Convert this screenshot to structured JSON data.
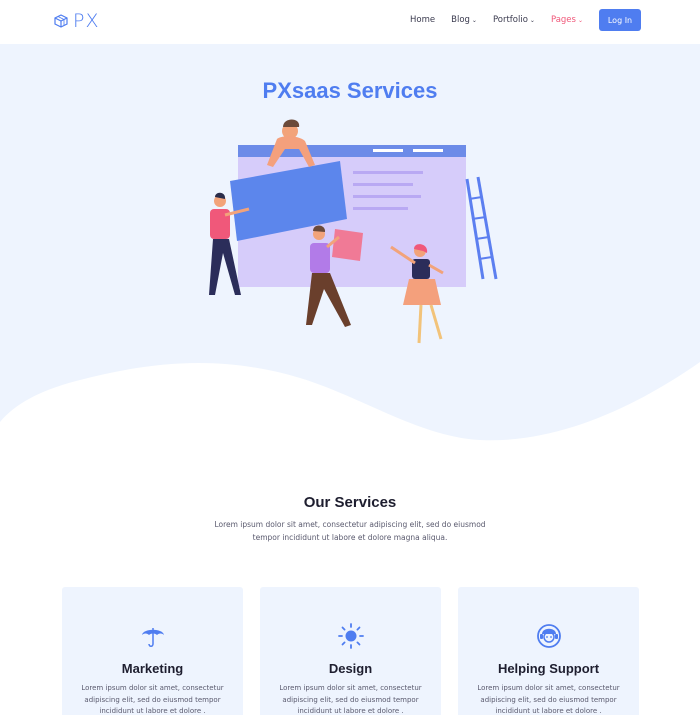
{
  "brand": {
    "logo_text": "PX"
  },
  "nav": {
    "items": [
      {
        "label": "Home",
        "has_dropdown": false,
        "active": false
      },
      {
        "label": "Blog",
        "has_dropdown": true,
        "active": false
      },
      {
        "label": "Portfolio",
        "has_dropdown": true,
        "active": false
      },
      {
        "label": "Pages",
        "has_dropdown": true,
        "active": true
      }
    ],
    "login_label": "Log In"
  },
  "hero": {
    "title": "PXsaas Services"
  },
  "services": {
    "title": "Our Services",
    "subtitle": "Lorem ipsum dolor sit amet, consectetur adipiscing elit, sed do eiusmod tempor incididunt ut labore et dolore magna aliqua.",
    "cards": [
      {
        "icon": "umbrella-icon",
        "title": "Marketing",
        "text": "Lorem ipsum dolor sit amet, consectetur adipiscing elit, sed do eiusmod tempor incididunt ut labore et dolore ."
      },
      {
        "icon": "sun-icon",
        "title": "Design",
        "text": "Lorem ipsum dolor sit amet, consectetur adipiscing elit, sed do eiusmod tempor incididunt ut labore et dolore ."
      },
      {
        "icon": "support-agent-icon",
        "title": "Helping Support",
        "text": "Lorem ipsum dolor sit amet, consectetur adipiscing elit, sed do eiusmod tempor incididunt ut labore et dolore ."
      }
    ]
  },
  "colors": {
    "accent": "#4f7df0",
    "active_nav": "#f0587a",
    "hero_bg": "#eef4fe",
    "card_bg": "#eef4fe"
  }
}
